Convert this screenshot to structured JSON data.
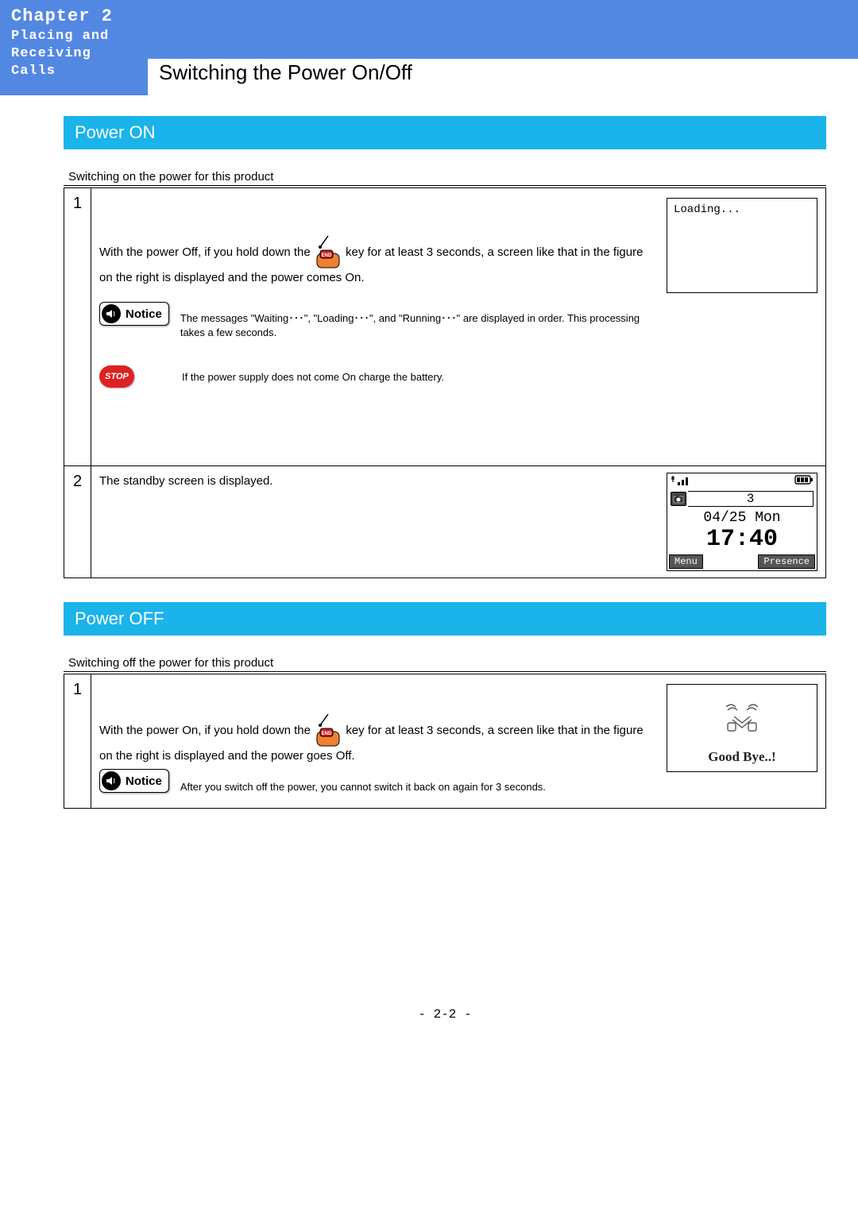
{
  "header": {
    "chapter_title": "Chapter 2",
    "chapter_sub": "Placing and Receiving Calls",
    "topic_title": "Switching the Power On/Off"
  },
  "power_on": {
    "section_title": "Power ON",
    "subheading": "Switching on the power for this product",
    "step1_num": "1",
    "step1_pre": "With the power Off, if you hold down the ",
    "step1_post": " key for at least 3 seconds, a screen like that in the figure on the right is displayed and the power comes On.",
    "notice_label": "Notice",
    "notice_text": "The messages \"Waiting･･･\", \"Loading･･･\", and \"Running･･･\" are displayed in order. This processing takes a few seconds.",
    "stop_label": "STOP",
    "stop_text": "If the power supply does not come On charge the battery.",
    "loading_text": "Loading...",
    "step2_num": "2",
    "step2_text": "The standby screen is displayed.",
    "standby": {
      "signal": "▾ııl",
      "battery": "▮▮▮",
      "field3": "3",
      "date": "04/25 Mon",
      "time": "17:40",
      "soft_left": "Menu",
      "soft_right": "Presence"
    }
  },
  "power_off": {
    "section_title": "Power OFF",
    "subheading": "Switching off the power for this product",
    "step1_num": "1",
    "step1_pre": "With the power On, if you hold down the ",
    "step1_post": " key for at least 3 seconds, a screen like that in the figure on the right is displayed and the power goes Off.",
    "notice_label": "Notice",
    "notice_text": "After you switch off the power, you cannot switch it back on again for 3 seconds.",
    "goodbye": "Good Bye..!"
  },
  "page_number": "- 2-2 -"
}
